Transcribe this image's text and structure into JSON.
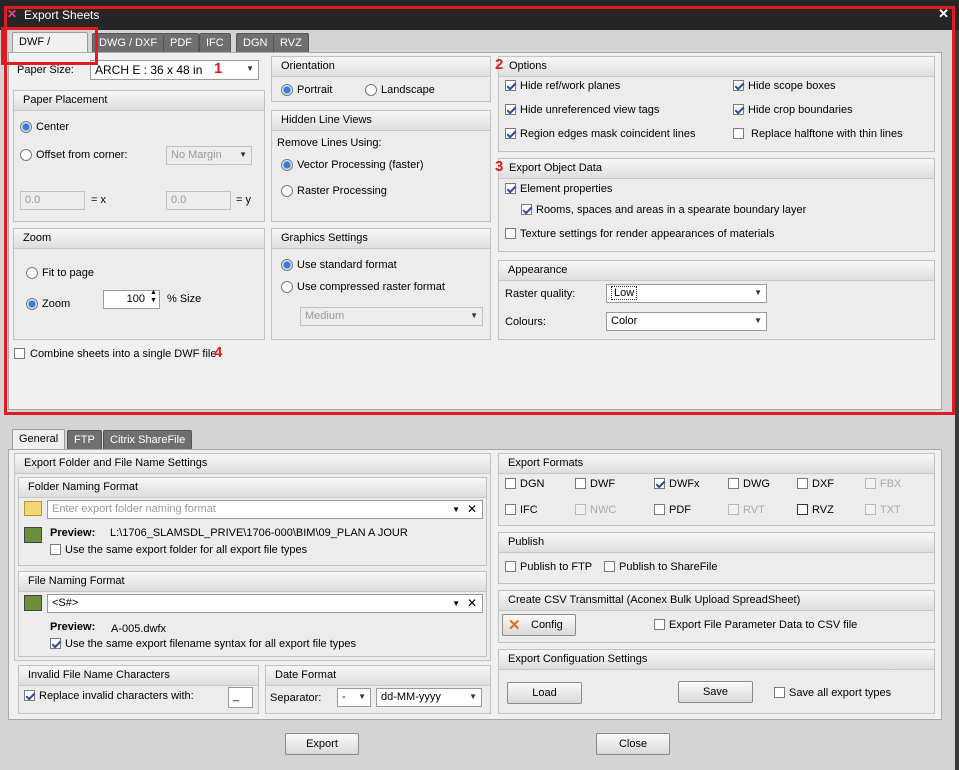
{
  "window": {
    "title": "Export Sheets",
    "close": "✕"
  },
  "top_tabs": [
    "DWF / DWFx",
    "DWG / DXF",
    "PDF",
    "IFC",
    "DGN",
    "RVZ"
  ],
  "paper": {
    "label": "Paper Size:",
    "value": "ARCH E : 36 x 48 in"
  },
  "placement": {
    "title": "Paper Placement",
    "center": "Center",
    "offset": "Offset from corner:",
    "offset_value": "No Margin",
    "x_value": "0.0",
    "x_label": "= x",
    "y_value": "0.0",
    "y_label": "= y"
  },
  "zoom": {
    "title": "Zoom",
    "fit": "Fit to page",
    "zoom": "Zoom",
    "zoom_value": "100",
    "size_label": "% Size"
  },
  "combine": "Combine sheets into a single DWF file",
  "orientation": {
    "title": "Orientation",
    "portrait": "Portrait",
    "landscape": "Landscape"
  },
  "hidden": {
    "title": "Hidden Line Views",
    "remove": "Remove Lines Using:",
    "vector": "Vector Processing (faster)",
    "raster": "Raster Processing"
  },
  "graphics": {
    "title": "Graphics Settings",
    "standard": "Use standard format",
    "compressed": "Use compressed raster format",
    "quality": "Medium"
  },
  "options": {
    "title": "Options",
    "items": [
      "Hide ref/work planes",
      "Hide scope boxes",
      "Hide unreferenced view tags",
      "Hide crop boundaries",
      "Region edges mask coincident lines",
      "Replace halftone with thin lines"
    ]
  },
  "export_obj": {
    "title": "Export Object Data",
    "element": "Element properties",
    "rooms": "Rooms, spaces and areas in a spearate boundary layer",
    "texture": "Texture settings for render appearances of materials"
  },
  "appearance": {
    "title": "Appearance",
    "raster_label": "Raster quality:",
    "raster_value": "Low",
    "colours_label": "Colours:",
    "colours_value": "Color"
  },
  "markers": [
    "1",
    "2",
    "3",
    "4"
  ],
  "bottom_tabs": [
    "General",
    "FTP",
    "Citrix ShareFile"
  ],
  "folder_settings": {
    "title": "Export Folder and File Name Settings",
    "folder_title": "Folder Naming Format",
    "folder_placeholder": "Enter export folder naming format",
    "preview_label": "Preview:",
    "folder_preview": "L:\\1706_SLAMSDL_PRIVE\\1706-000\\BIM\\09_PLAN A JOUR",
    "folder_same": "Use the same export folder for all export file types",
    "file_title": "File Naming Format",
    "file_value": "<S#>",
    "file_preview": "A-005.dwfx",
    "file_same": "Use the same export filename syntax for all export file types"
  },
  "invalid": {
    "title": "Invalid File Name Characters",
    "replace": "Replace invalid characters with:",
    "char": "_"
  },
  "date": {
    "title": "Date Format",
    "sep_label": "Separator:",
    "sep_value": "-",
    "format": "dd-MM-yyyy"
  },
  "formats": {
    "title": "Export Formats",
    "items": [
      "DGN",
      "DWF",
      "DWFx",
      "DWG",
      "DXF",
      "FBX",
      "IFC",
      "NWC",
      "PDF",
      "RVT",
      "RVZ",
      "TXT"
    ]
  },
  "publish": {
    "title": "Publish",
    "ftp": "Publish to FTP",
    "share": "Publish to ShareFile"
  },
  "csv": {
    "title": "Create CSV Transmittal (Aconex Bulk Upload SpreadSheet)",
    "config": "Config",
    "param": "Export File Parameter Data to CSV file"
  },
  "config_settings": {
    "title": "Export Configuation Settings",
    "load": "Load",
    "save": "Save",
    "save_all": "Save all export types"
  },
  "footer": {
    "export": "Export",
    "close": "Close"
  }
}
